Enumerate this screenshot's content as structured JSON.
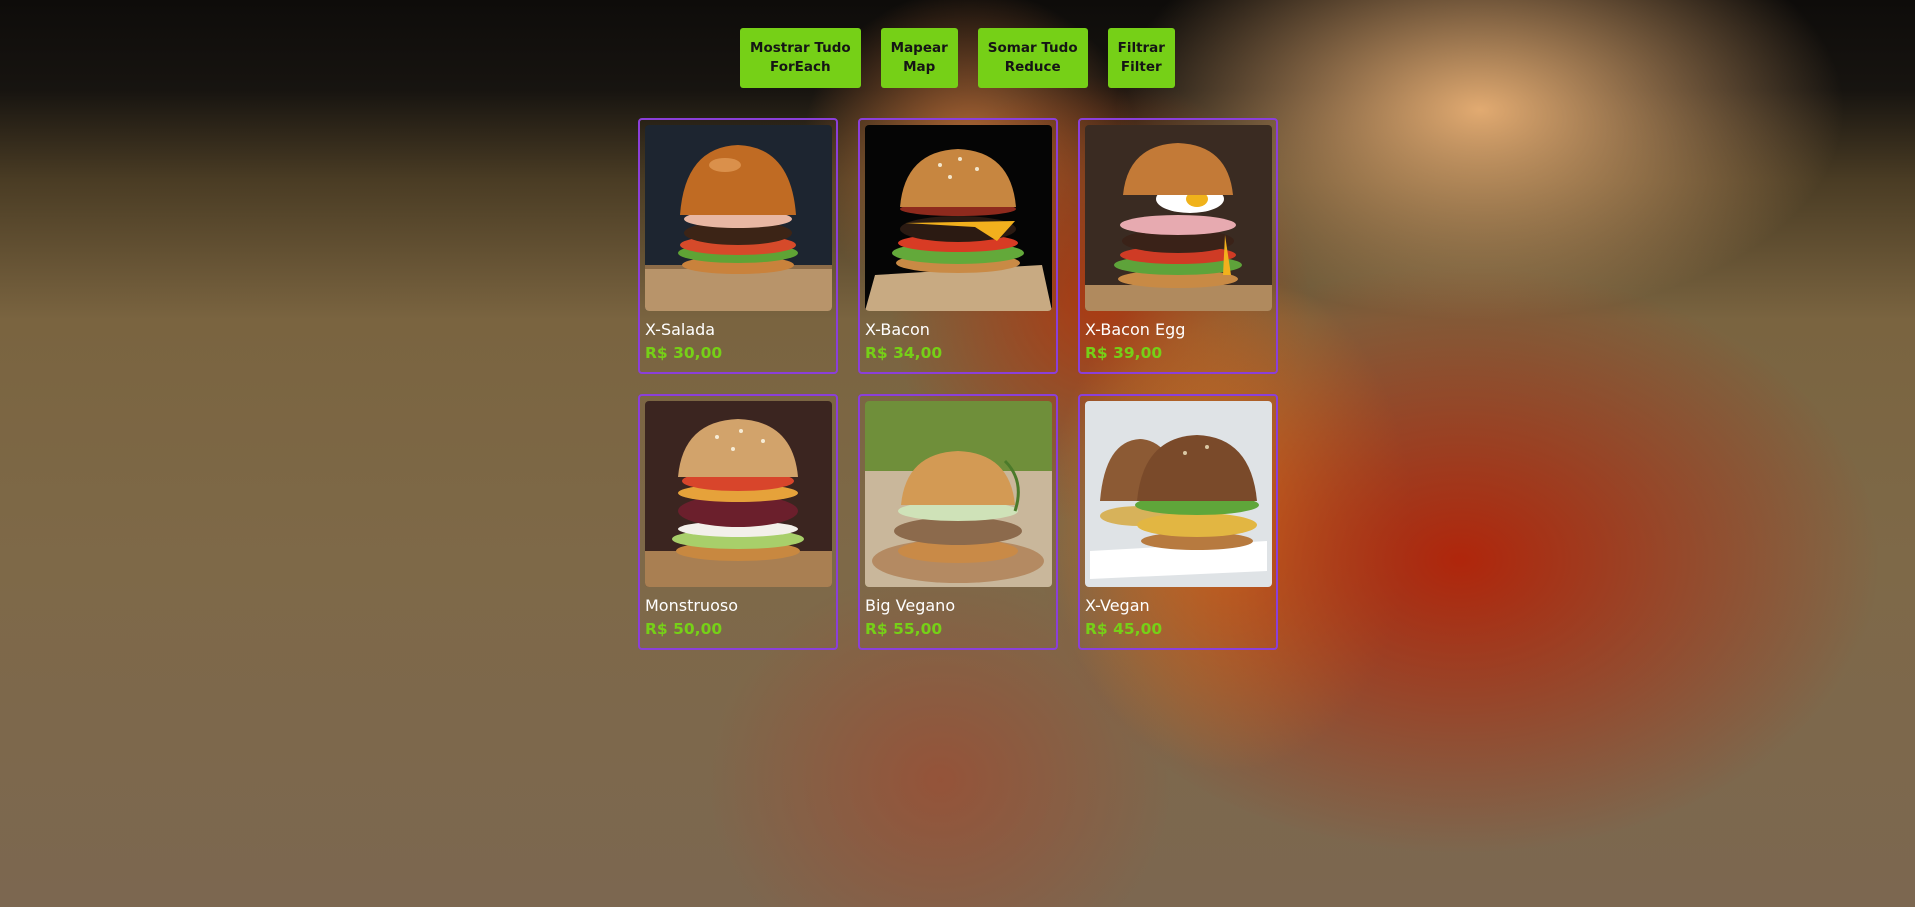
{
  "buttons": [
    {
      "line1": "Mostrar Tudo",
      "line2": "ForEach"
    },
    {
      "line1": "Mapear",
      "line2": "Map"
    },
    {
      "line1": "Somar Tudo",
      "line2": "Reduce"
    },
    {
      "line1": "Filtrar",
      "line2": "Filter"
    }
  ],
  "menu": [
    {
      "name": "X-Salada",
      "price": "R$ 30,00",
      "photo": "burger-photo"
    },
    {
      "name": "X-Bacon",
      "price": "R$ 34,00",
      "photo": "burger-photo"
    },
    {
      "name": "X-Bacon Egg",
      "price": "R$ 39,00",
      "photo": "burger-photo"
    },
    {
      "name": "Monstruoso",
      "price": "R$ 50,00",
      "photo": "burger-photo"
    },
    {
      "name": "Big Vegano",
      "price": "R$ 55,00",
      "photo": "burger-photo"
    },
    {
      "name": "X-Vegan",
      "price": "R$ 45,00",
      "photo": "burger-photo"
    }
  ],
  "colors": {
    "accent_green": "#76d017",
    "card_border": "#8b3fd9",
    "text_white": "#ffffff"
  }
}
